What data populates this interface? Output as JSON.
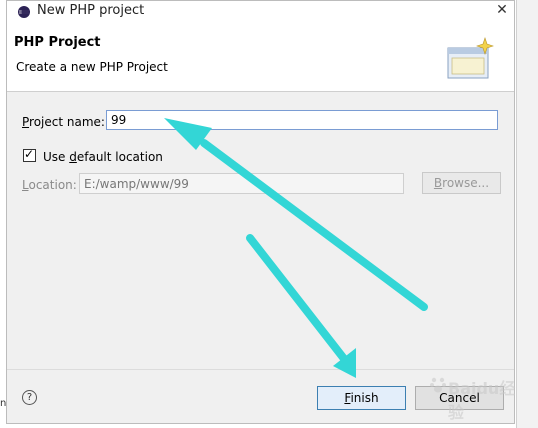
{
  "window": {
    "title": "New PHP project"
  },
  "header": {
    "title": "PHP Project",
    "description": "Create a new PHP Project"
  },
  "form": {
    "project_name_label_mnemonic": "P",
    "project_name_label_rest": "roject name:",
    "project_name_value": "99",
    "use_default_prefix": "Use ",
    "use_default_mnemonic": "d",
    "use_default_rest": "efault location",
    "use_default_checked": true,
    "location_label_mnemonic": "L",
    "location_label_rest": "ocation:",
    "location_value": "E:/wamp/www/99",
    "browse_mnemonic": "B",
    "browse_rest": "rowse..."
  },
  "footer": {
    "help_glyph": "?",
    "finish_mnemonic": "F",
    "finish_rest": "inish",
    "cancel_label": "Cancel"
  },
  "overlay": {
    "arrow_color": "#33d6d6",
    "watermark_text": "Baidu经验"
  }
}
